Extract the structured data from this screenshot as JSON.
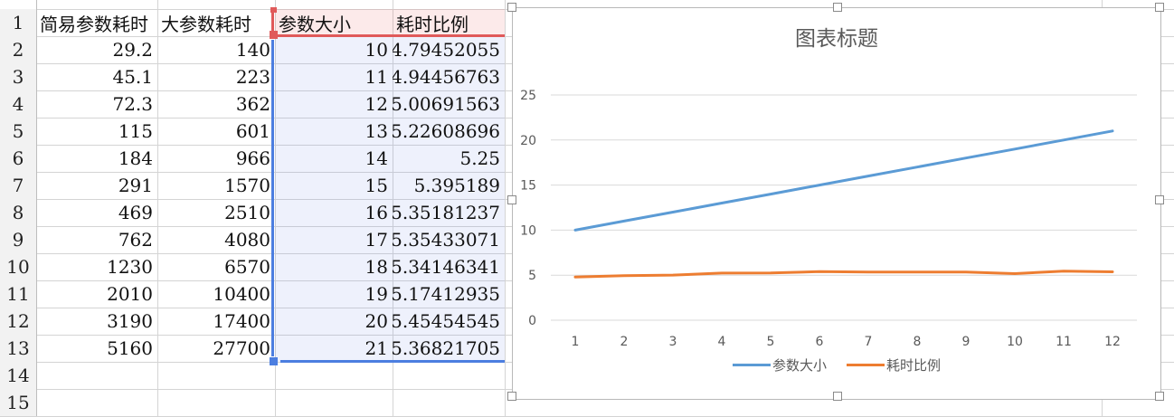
{
  "spreadsheet": {
    "row_numbers": [
      "1",
      "2",
      "3",
      "4",
      "5",
      "6",
      "7",
      "8",
      "9",
      "10",
      "11",
      "12",
      "13",
      "14",
      "15"
    ],
    "headers": [
      "简易参数耗时",
      "大参数耗时",
      "参数大小",
      "耗时比例"
    ],
    "rows": [
      [
        "29.2",
        "140",
        "10",
        "4.79452055"
      ],
      [
        "45.1",
        "223",
        "11",
        "4.94456763"
      ],
      [
        "72.3",
        "362",
        "12",
        "5.00691563"
      ],
      [
        "115",
        "601",
        "13",
        "5.22608696"
      ],
      [
        "184",
        "966",
        "14",
        "5.25"
      ],
      [
        "291",
        "1570",
        "15",
        "5.395189"
      ],
      [
        "469",
        "2510",
        "16",
        "5.35181237"
      ],
      [
        "762",
        "4080",
        "17",
        "5.35433071"
      ],
      [
        "1230",
        "6570",
        "18",
        "5.34146341"
      ],
      [
        "2010",
        "10400",
        "19",
        "5.17412935"
      ],
      [
        "3190",
        "17400",
        "20",
        "5.45454545"
      ],
      [
        "5160",
        "27700",
        "21",
        "5.36821705"
      ]
    ]
  },
  "chart_data": {
    "type": "line",
    "title": "图表标题",
    "categories": [
      "1",
      "2",
      "3",
      "4",
      "5",
      "6",
      "7",
      "8",
      "9",
      "10",
      "11",
      "12"
    ],
    "ylim": [
      0,
      25
    ],
    "yticks": [
      "0",
      "5",
      "10",
      "15",
      "20",
      "25"
    ],
    "grid": true,
    "legend": "bottom",
    "series": [
      {
        "name": "参数大小",
        "color": "#5b9bd5",
        "values": [
          10,
          11,
          12,
          13,
          14,
          15,
          16,
          17,
          18,
          19,
          20,
          21
        ]
      },
      {
        "name": "耗时比例",
        "color": "#ed7d31",
        "values": [
          4.79452055,
          4.94456763,
          5.00691563,
          5.22608696,
          5.25,
          5.395189,
          5.35181237,
          5.35433071,
          5.34146341,
          5.17412935,
          5.45454545,
          5.36821705
        ]
      }
    ]
  }
}
